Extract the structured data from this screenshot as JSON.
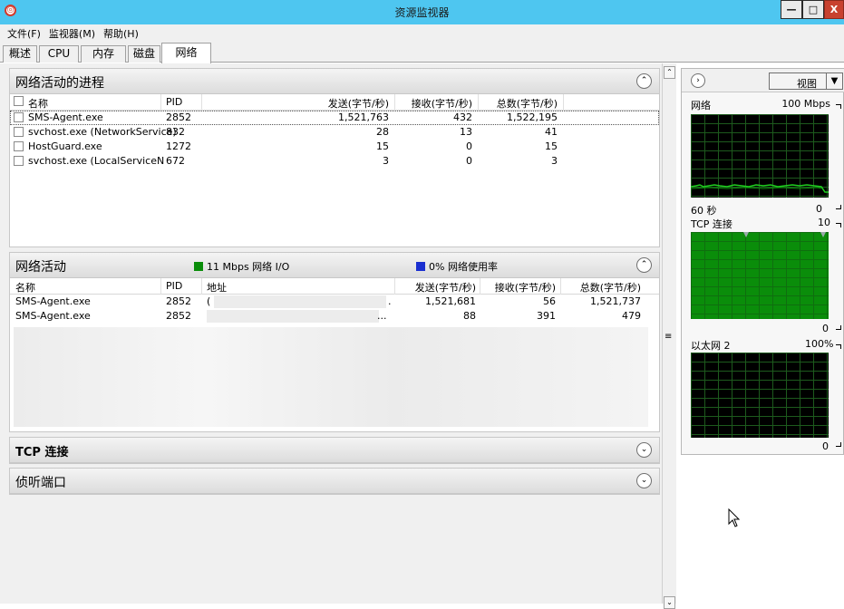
{
  "window": {
    "title": "资源监视器",
    "min": "—",
    "max": "□",
    "close": "X"
  },
  "menu": [
    "文件(F)",
    "监视器(M)",
    "帮助(H)"
  ],
  "tabs": [
    "概述",
    "CPU",
    "内存",
    "磁盘",
    "网络"
  ],
  "active_tab": "网络",
  "processes": {
    "title": "网络活动的进程",
    "columns": {
      "name": "名称",
      "pid": "PID",
      "send": "发送(字节/秒)",
      "recv": "接收(字节/秒)",
      "total": "总数(字节/秒)"
    },
    "rows": [
      {
        "name": "SMS-Agent.exe",
        "pid": "2852",
        "send": "1,521,763",
        "recv": "432",
        "total": "1,522,195"
      },
      {
        "name": "svchost.exe (NetworkService)",
        "pid": "832",
        "send": "28",
        "recv": "13",
        "total": "41"
      },
      {
        "name": "HostGuard.exe",
        "pid": "1272",
        "send": "15",
        "recv": "0",
        "total": "15"
      },
      {
        "name": "svchost.exe (LocalServiceN...",
        "pid": "672",
        "send": "3",
        "recv": "0",
        "total": "3"
      }
    ]
  },
  "activity": {
    "title": "网络活动",
    "legend_io": "11 Mbps 网络 I/O",
    "legend_usage": "0% 网络使用率",
    "io_color": "#0a8d0a",
    "usage_color": "#1a2fd0",
    "columns": {
      "name": "名称",
      "pid": "PID",
      "addr": "地址",
      "send": "发送(字节/秒)",
      "recv": "接收(字节/秒)",
      "total": "总数(字节/秒)"
    },
    "rows": [
      {
        "name": "SMS-Agent.exe",
        "pid": "2852",
        "addr": "(",
        "addr_tail": ".",
        "send": "1,521,681",
        "recv": "56",
        "total": "1,521,737"
      },
      {
        "name": "SMS-Agent.exe",
        "pid": "2852",
        "addr": "",
        "addr_tail": "...",
        "send": "88",
        "recv": "391",
        "total": "479"
      }
    ]
  },
  "tcp": {
    "title": "TCP 连接"
  },
  "listen": {
    "title": "侦听端口"
  },
  "right": {
    "view": "视图",
    "net_label": "网络",
    "net_max": "100 Mbps",
    "net_time": "60 秒",
    "net_min": "0",
    "tcp_label": "TCP 连接",
    "tcp_max": "10",
    "tcp_min": "0",
    "eth_label": "以太网 2",
    "eth_max": "100%",
    "eth_min": "0"
  }
}
